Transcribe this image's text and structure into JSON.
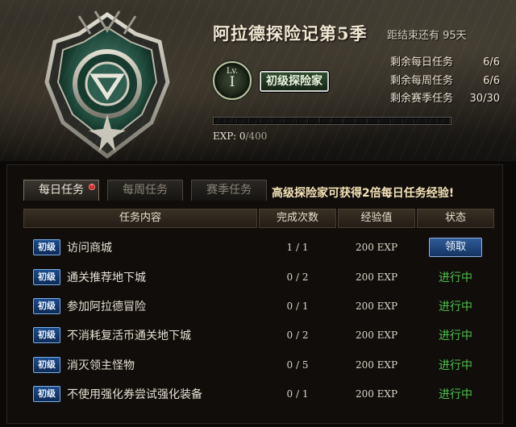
{
  "header": {
    "title": "阿拉德探险记第5季",
    "countdown": "距结束还有 95天",
    "level": {
      "prefix": "Lv.",
      "value": "I"
    },
    "rank_name": "初级探险家",
    "remaining": [
      {
        "label": "剩余每日任务",
        "value": "6/6"
      },
      {
        "label": "剩余每周任务",
        "value": "6/6"
      },
      {
        "label": "剩余赛季任务",
        "value": "30/30"
      }
    ],
    "exp": {
      "label": "EXP:",
      "current": "0",
      "max": "/400",
      "progress_fraction": 0
    }
  },
  "tabs": [
    {
      "label": "每日任务",
      "active": true,
      "alert": "!"
    },
    {
      "label": "每周任务",
      "active": false
    },
    {
      "label": "赛季任务",
      "active": false
    }
  ],
  "notice": "高级探险家可获得2倍每日任务经验!",
  "columns": [
    "任务内容",
    "完成次数",
    "经验值",
    "状态"
  ],
  "tasks": [
    {
      "tier": "初级",
      "name": "访问商城",
      "count": "1 / 1",
      "exp": "200 EXP",
      "status": "领取",
      "claimable": true
    },
    {
      "tier": "初级",
      "name": "通关推荐地下城",
      "count": "0 / 2",
      "exp": "200 EXP",
      "status": "进行中",
      "claimable": false
    },
    {
      "tier": "初级",
      "name": "参加阿拉德冒险",
      "count": "0 / 1",
      "exp": "200 EXP",
      "status": "进行中",
      "claimable": false
    },
    {
      "tier": "初级",
      "name": "不消耗复活币通关地下城",
      "count": "0 / 2",
      "exp": "200 EXP",
      "status": "进行中",
      "claimable": false
    },
    {
      "tier": "初级",
      "name": "消灭领主怪物",
      "count": "0 / 5",
      "exp": "200 EXP",
      "status": "进行中",
      "claimable": false
    },
    {
      "tier": "初级",
      "name": "不使用强化券尝试强化装备",
      "count": "0 / 1",
      "exp": "200 EXP",
      "status": "进行中",
      "claimable": false
    }
  ],
  "colors": {
    "in_progress": "#4cc24a",
    "tier_blue": "#1c4c8a",
    "accent_gold": "#f6e3b8"
  },
  "icons": {
    "emblem": "adventure-emblem-icon",
    "alert": "alert-dot-icon"
  }
}
